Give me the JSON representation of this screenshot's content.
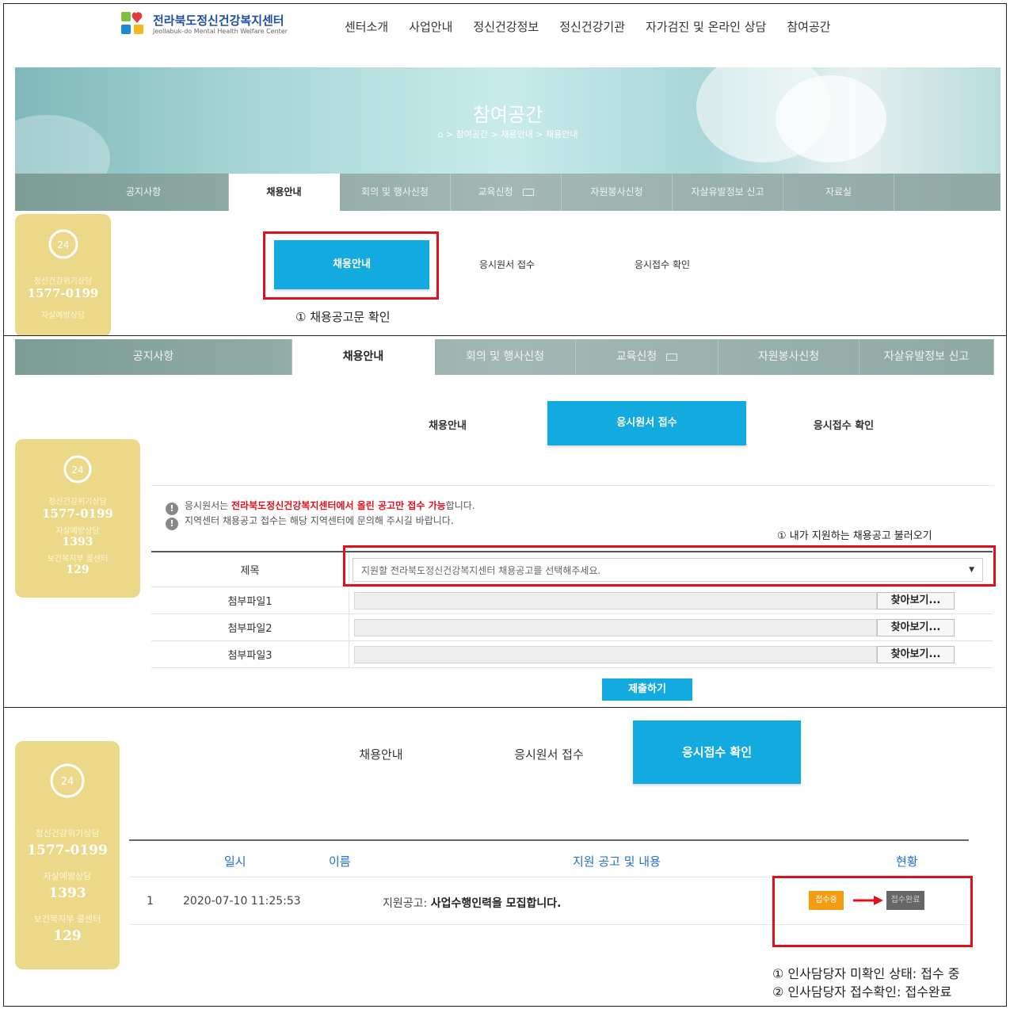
{
  "logo": {
    "title": "전라북도정신건강복지센터",
    "subtitle": "Jeollabuk-do Mental Health Welfare Center"
  },
  "gnb": [
    "센터소개",
    "사업안내",
    "정신건강정보",
    "정신건강기관",
    "자가검진 및 온라인 상담",
    "참여공간"
  ],
  "hero": {
    "title": "참여공간",
    "breadcrumb": "> 참여공간 > 채용안내 > 채용안내"
  },
  "subnav": [
    "공지사항",
    "채용안내",
    "회의 및 행사신청",
    "교육신청",
    "자원봉사신청",
    "자살유발정보 신고",
    "자료실"
  ],
  "subnav_active": "채용안내",
  "phone": {
    "badge": "24",
    "crisis_label": "정신건강위기상담",
    "crisis_number": "1577-0199",
    "suicide_label": "자살예방상담",
    "suicide_number": "1393",
    "welfare_label": "보건복지부 콜센터",
    "welfare_number": "129"
  },
  "tabs": [
    "채용안내",
    "응시원서 접수",
    "응시접수 확인"
  ],
  "panel1": {
    "caption": "① 채용공고문 확인"
  },
  "panel2": {
    "notice1_pre": "응시원서는 ",
    "notice1_highlight": "전라북도정신건강복지센터에서 올린 공고만 접수 가능",
    "notice1_post": "합니다.",
    "notice2": "지역센터 채용공고 접수는 해당 지역센터에 문의해 주시길 바랍니다.",
    "caption": "① 내가 지원하는 채용공고 불러오기",
    "title_label": "제목",
    "title_placeholder": "지원할 전라북도정신건강복지센터 채용공고를 선택해주세요.",
    "attachments": [
      {
        "label": "첨부파일1",
        "browse": "찾아보기..."
      },
      {
        "label": "첨부파일2",
        "browse": "찾아보기..."
      },
      {
        "label": "첨부파일3",
        "browse": "찾아보기..."
      }
    ],
    "submit": "제출하기"
  },
  "panel3": {
    "headers": [
      "일시",
      "이름",
      "지원 공고 및 내용",
      "현황"
    ],
    "row": {
      "no": "1",
      "date": "2020-07-10 11:25:53",
      "prefix": "지원공고: ",
      "title": "사업수행인력을 모집합니다."
    },
    "status_pending": "접수중",
    "status_done": "접수완료",
    "note1": "① 인사담당자 미확인 상태: 접수 중",
    "note2": "② 인사담당자 접수확인: 접수완료"
  },
  "colors": {
    "accent": "#13aadf",
    "highlight_box": "#e0101c",
    "side_panel": "#ecd889",
    "pending": "#f39c12",
    "done": "#666666"
  }
}
